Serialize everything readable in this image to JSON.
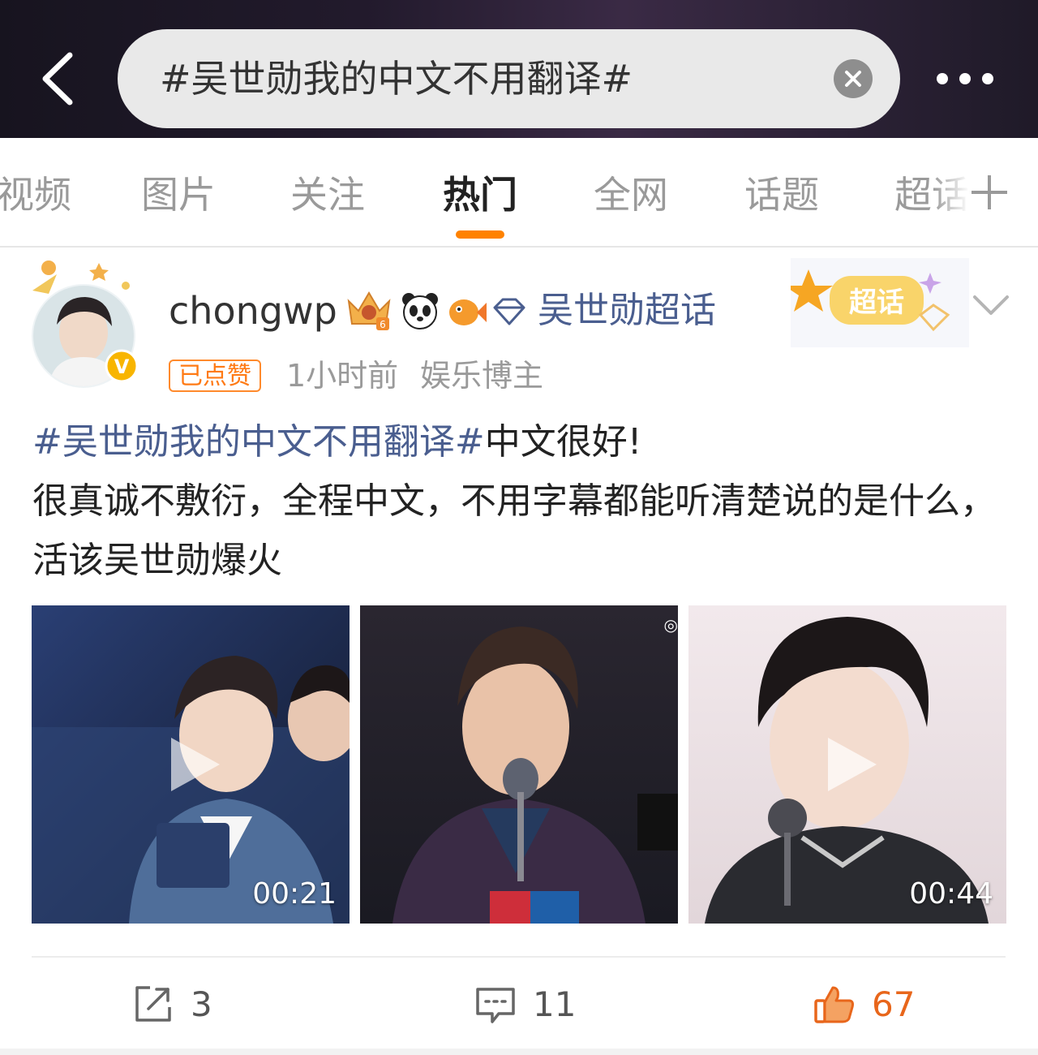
{
  "search": {
    "query": "#吴世勋我的中文不用翻译#"
  },
  "tabs": [
    {
      "label": "视频",
      "active": false
    },
    {
      "label": "图片",
      "active": false
    },
    {
      "label": "关注",
      "active": false
    },
    {
      "label": "热门",
      "active": true
    },
    {
      "label": "全网",
      "active": false
    },
    {
      "label": "话题",
      "active": false
    },
    {
      "label": "超话",
      "active": false
    }
  ],
  "post": {
    "username": "chongwp",
    "super_topic_link": "吴世勋超话",
    "super_topic_badge": "超话",
    "liked_badge": "已点赞",
    "time": "1小时前",
    "role": "娱乐博主",
    "hashtag": "#吴世勋我的中文不用翻译#",
    "text_after_hashtag": "中文很好!",
    "text_body": "很真诚不敷衍，全程中文，不用字幕都能听清楚说的是什么，活该吴世勋爆火",
    "media": [
      {
        "type": "video",
        "duration": "00:21"
      },
      {
        "type": "image",
        "duration": ""
      },
      {
        "type": "video",
        "duration": "00:44"
      }
    ],
    "actions": {
      "repost_count": "3",
      "comment_count": "11",
      "like_count": "67"
    }
  },
  "colors": {
    "accent": "#ff8200",
    "link": "#4a5e8f",
    "like": "#e8661b"
  }
}
